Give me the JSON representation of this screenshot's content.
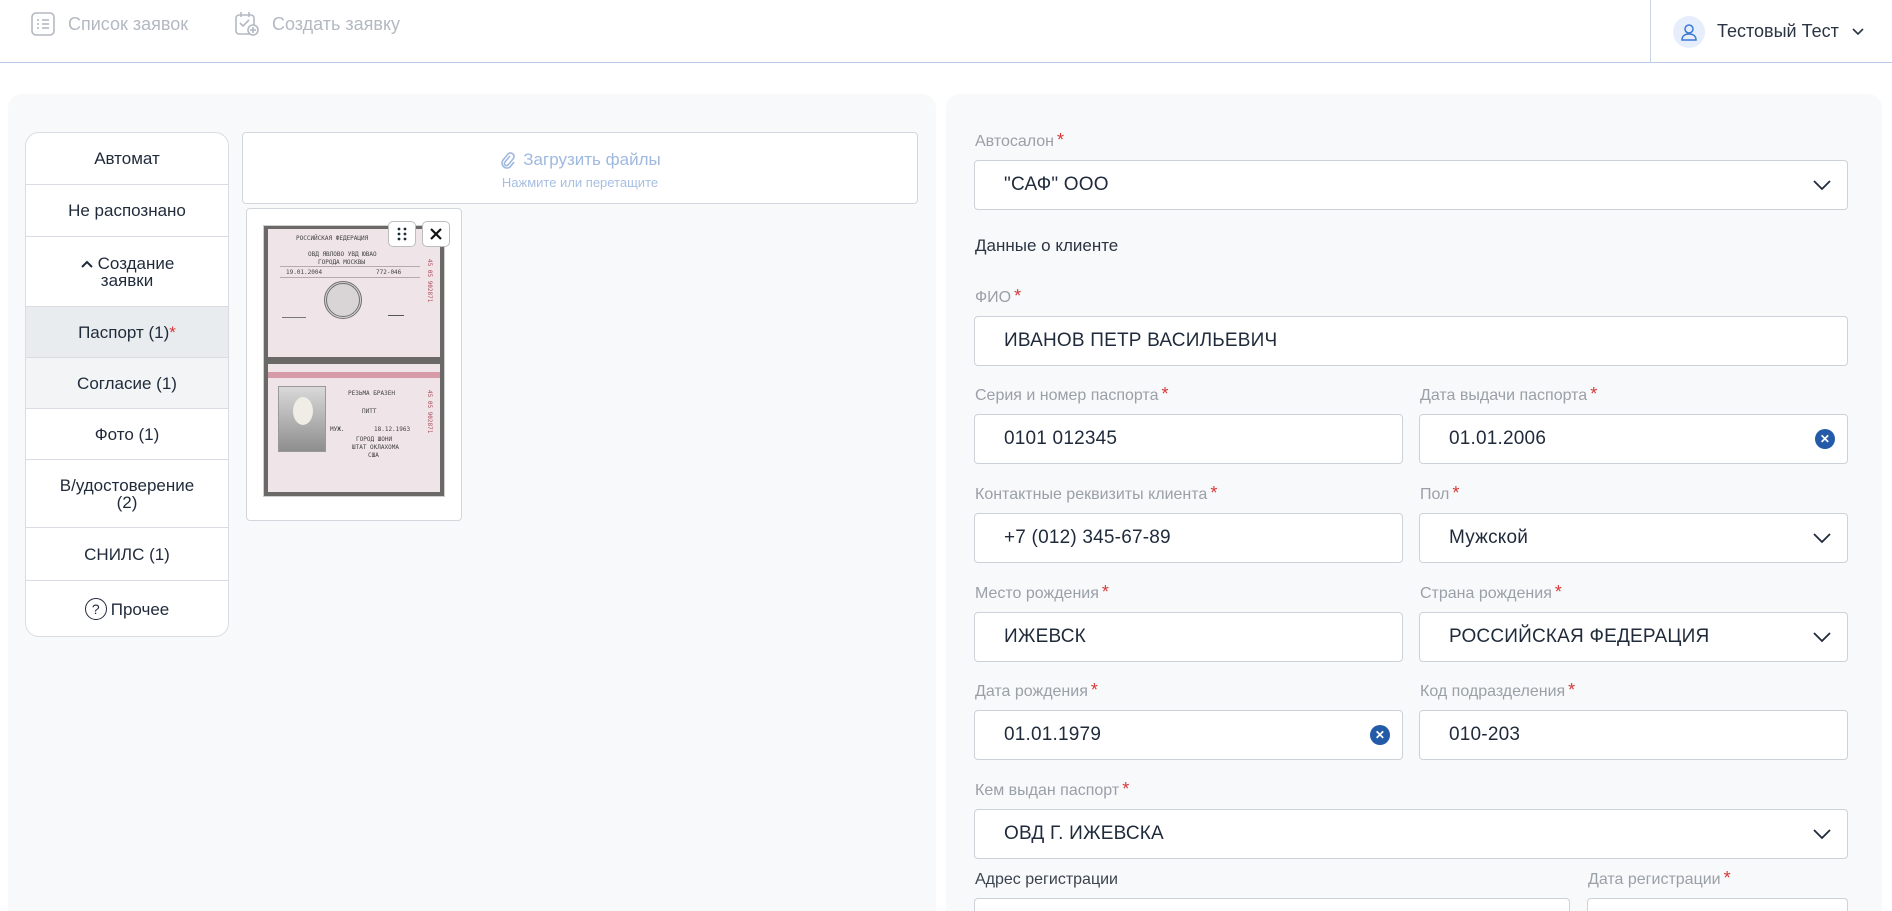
{
  "nav": {
    "list_label": "Список заявок",
    "create_label": "Создать заявку"
  },
  "user": {
    "name": "Тестовый Тест"
  },
  "categories": {
    "auto": "Автомат",
    "unrecognized": "Не распознано",
    "create_request": "Создание заявки",
    "passport": "Паспорт (1)",
    "passport_required": "*",
    "consent": "Согласие (1)",
    "photo": "Фото (1)",
    "license": "В/удостоверение (2)",
    "snils": "СНИЛС (1)",
    "other": "Прочее",
    "other_icon_glyph": "?"
  },
  "upload": {
    "title": "Загрузить файлы",
    "hint": "Нажмите или перетащите"
  },
  "passport_image": {
    "top_header": "РОССИЙСКАЯ ФЕДЕРАЦИЯ",
    "issued_by": "ОВД ЯВЛОВО УВД ЮВАО",
    "city": "ГОРОДА МОСКВЫ",
    "issue_date": "19.01.2004",
    "code": "772-046",
    "surname": "РЕЗЬМА БРАЗЕН",
    "name": "ПИТТ",
    "sex": "МУЖ.",
    "birth": "18.12.1963",
    "place1": "ГОРОД ШОНИ",
    "place2": "ШТАТ ОКЛАХОМА",
    "place3": "США",
    "side_number": "45 05 902871"
  },
  "form": {
    "required_mark": "*",
    "dealer_label": "Автосалон",
    "dealer_value": "\"САФ\" ООО",
    "client_section": "Данные о клиенте",
    "fio_label": "ФИО",
    "fio_value": "ИВАНОВ ПЕТР ВАСИЛЬЕВИЧ",
    "passport_number_label": "Серия и номер паспорта",
    "passport_number_value": "0101 012345",
    "issue_date_label": "Дата выдачи паспорта",
    "issue_date_value": "01.01.2006",
    "contact_label": "Контактные реквизиты клиента",
    "contact_value": "+7 (012) 345-67-89",
    "sex_label": "Пол",
    "sex_value": "Мужской",
    "birth_place_label": "Место рождения",
    "birth_place_value": "ИЖЕВСК",
    "birth_country_label": "Страна рождения",
    "birth_country_value": "РОССИЙСКАЯ ФЕДЕРАЦИЯ",
    "birth_date_label": "Дата рождения",
    "birth_date_value": "01.01.1979",
    "division_code_label": "Код подразделения",
    "division_code_value": "010-203",
    "issued_by_label": "Кем выдан паспорт",
    "issued_by_value": "ОВД Г. ИЖЕВСКА",
    "reg_address_label": "Адрес регистрации",
    "reg_date_label": "Дата регистрации"
  },
  "colors": {
    "accent": "#235ba8",
    "required": "#d63838",
    "muted": "#9aa0a8",
    "upload_link": "#9fb8e0"
  },
  "icons": {
    "list": "list-icon",
    "create": "calendar-add-icon",
    "user": "user-icon",
    "dropdown": "chevron-down-icon",
    "attach": "paperclip-icon",
    "drag": "drag-handle-icon",
    "close": "close-icon",
    "clear": "clear-circle-icon",
    "help": "question-circle-icon",
    "collapse": "chevron-up-icon"
  }
}
